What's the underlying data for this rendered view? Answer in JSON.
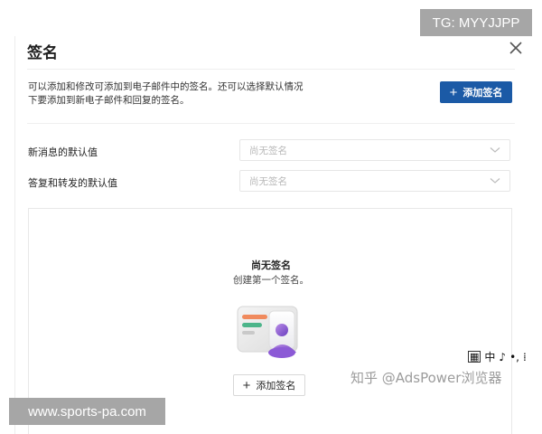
{
  "dialog": {
    "title": "签名",
    "description_line1": "可以添加和修改可添加到电子邮件中的签名。还可以选择默认情况",
    "description_line2": "下要添加到新电子邮件和回复的签名。",
    "add_button_label": "添加签名"
  },
  "defaults": {
    "new_message_label": "新消息的默认值",
    "new_message_value": "尚无签名",
    "reply_forward_label": "答复和转发的默认值",
    "reply_forward_value": "尚无签名"
  },
  "empty_state": {
    "title": "尚无签名",
    "subtitle": "创建第一个签名。",
    "add_button_label": "添加签名"
  },
  "overlays": {
    "tg_badge": "TG: MYYJJPP",
    "site_badge": "www.sports-pa.com",
    "ime_indicator": [
      "中",
      "♪",
      "•,",
      "⁞"
    ],
    "watermark": "知乎 @AdsPower浏览器"
  },
  "icons": [
    "close-icon",
    "plus-icon",
    "chevron-down-icon",
    "signature-card-illustration",
    "keyboard-icon"
  ],
  "colors": {
    "primary": "#1b5aa6",
    "border": "#e6e6e6",
    "placeholder": "#b8b8b8"
  }
}
